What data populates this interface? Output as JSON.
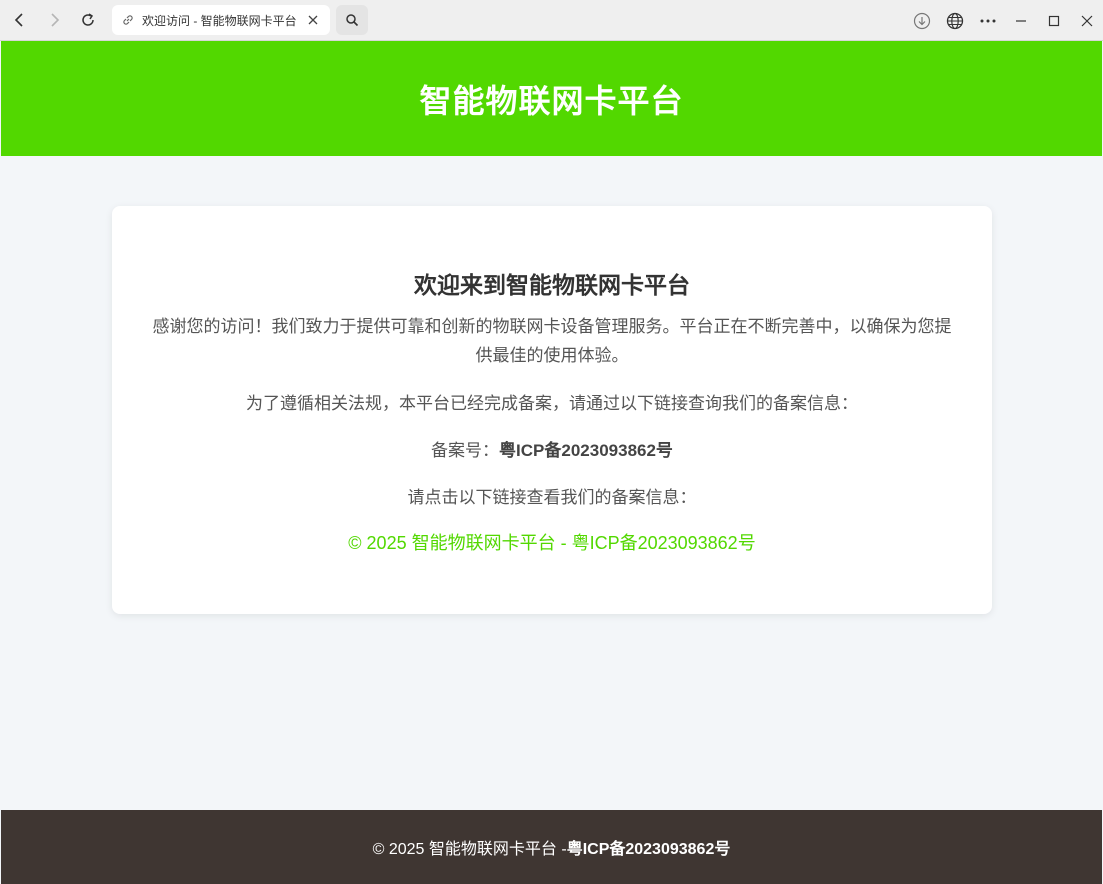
{
  "browser": {
    "tab_title": "欢迎访问 - 智能物联网卡平台",
    "icons": [
      "back-icon",
      "forward-icon",
      "reload-icon",
      "link-icon",
      "close-icon",
      "search-icon",
      "download-icon",
      "globe-icon",
      "more-icon",
      "minimize-icon",
      "maximize-icon",
      "window-close-icon"
    ]
  },
  "header": {
    "title": "智能物联网卡平台"
  },
  "main": {
    "heading": "欢迎来到智能物联网卡平台",
    "intro": "感谢您的访问！我们致力于提供可靠和创新的物联网卡设备管理服务。平台正在不断完善中，以确保为您提供最佳的使用体验。",
    "compliance": "为了遵循相关法规，本平台已经完成备案，请通过以下链接查询我们的备案信息：",
    "record_label": "备案号：",
    "record_number": "粤ICP备2023093862号",
    "click_prompt": "请点击以下链接查看我们的备案信息：",
    "record_link_text": "© 2025 智能物联网卡平台 - 粤ICP备2023093862号"
  },
  "footer": {
    "copyright": "© 2025 智能物联网卡平台 - ",
    "record_number": "粤ICP备2023093862号"
  },
  "colors": {
    "brand_green": "#52d800",
    "footer_bg": "#3f3632",
    "page_bg": "#f3f6f9"
  }
}
